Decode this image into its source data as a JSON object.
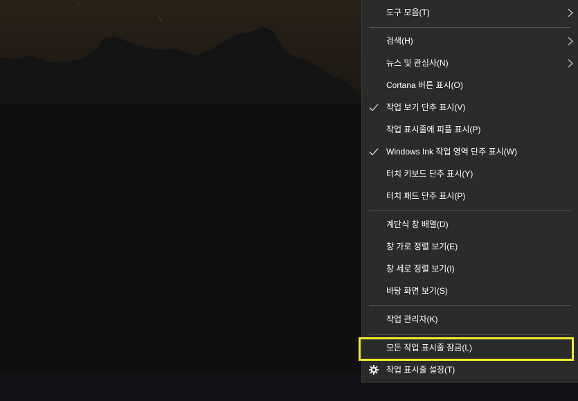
{
  "menu": {
    "items": [
      {
        "label": "도구 모음(T)",
        "submenu": true,
        "checked": false
      },
      {
        "label": "검색(H)",
        "submenu": true,
        "checked": false
      },
      {
        "label": "뉴스 및 관심사(N)",
        "submenu": true,
        "checked": false
      },
      {
        "label": "Cortana 버튼 표시(O)",
        "submenu": false,
        "checked": false
      },
      {
        "label": "작업 보기 단추 표시(V)",
        "submenu": false,
        "checked": true
      },
      {
        "label": "작업 표시줄에 피플 표시(P)",
        "submenu": false,
        "checked": false
      },
      {
        "label": "Windows Ink 작업 영역 단추 표시(W)",
        "submenu": false,
        "checked": true
      },
      {
        "label": "터치 키보드 단추 표시(Y)",
        "submenu": false,
        "checked": false
      },
      {
        "label": "터치 패드 단추 표시(P)",
        "submenu": false,
        "checked": false
      },
      {
        "label": "계단식 창 배열(D)",
        "submenu": false,
        "checked": false
      },
      {
        "label": "창 가로 정렬 보기(E)",
        "submenu": false,
        "checked": false
      },
      {
        "label": "창 세로 정렬 보기(I)",
        "submenu": false,
        "checked": false
      },
      {
        "label": "바탕 화면 보기(S)",
        "submenu": false,
        "checked": false
      },
      {
        "label": "작업 관리자(K)",
        "submenu": false,
        "checked": false
      },
      {
        "label": "모든 작업 표시줄 잠금(L)",
        "submenu": false,
        "checked": false,
        "highlighted": true
      },
      {
        "label": "작업 표시줄 설정(T)",
        "submenu": false,
        "checked": false,
        "icon": "gear-icon"
      }
    ]
  },
  "colors": {
    "menu_background": "#2b2b2b",
    "menu_text": "#ffffff",
    "highlight_border": "#f4ef2a",
    "desktop_background": "#0c0c0d"
  }
}
